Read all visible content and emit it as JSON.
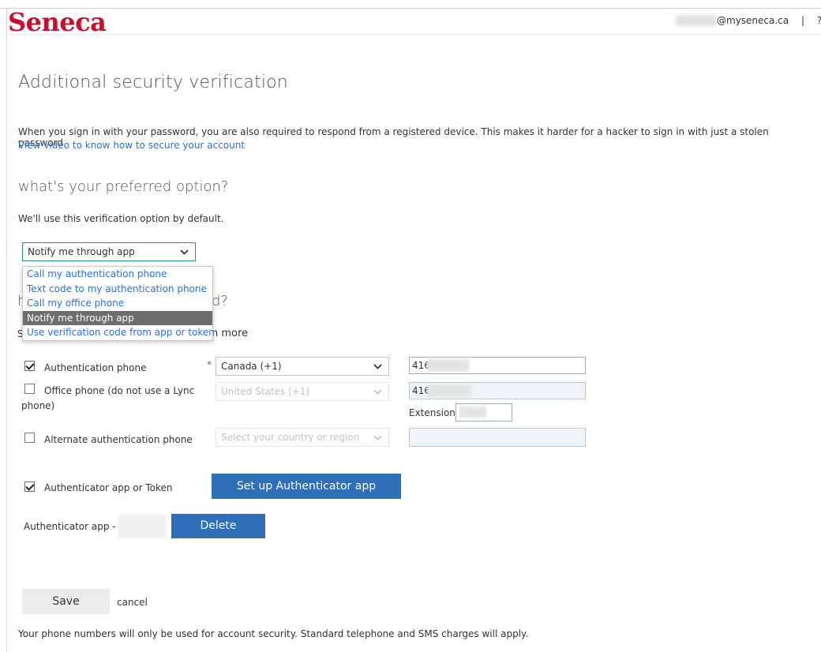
{
  "header": {
    "logo_text": "Seneca",
    "user_email": "@myseneca.ca",
    "separator": "|"
  },
  "page": {
    "title": "Additional security verification",
    "description": "When you sign in with your password, you are also required to respond from a registered device. This makes it harder for a hacker to sign in with just a stolen password.",
    "video_link": "View video to know how to secure your account"
  },
  "preferred": {
    "heading": "what's your preferred option?",
    "subtext": "We'll use this verification option by default.",
    "selected": "Notify me through app",
    "options": [
      "Call my authentication phone",
      "Text code to my authentication phone",
      "Call my office phone",
      "Notify me through app",
      "Use verification code from app or token"
    ]
  },
  "respond": {
    "heading_left": "h",
    "heading_right": "d?",
    "sub_left": "S",
    "learn_more_suffix": "n more"
  },
  "phones": {
    "auth_phone": {
      "label": "Authentication phone",
      "checked": true,
      "country": "Canada (+1)",
      "number_prefix": "416"
    },
    "office_phone": {
      "label_line1": "Office phone (do not use a Lync",
      "label_line2": "phone)",
      "checked": false,
      "country": "United States (+1)",
      "number_prefix": "416",
      "extension_label": "Extension"
    },
    "alternate_phone": {
      "label": "Alternate authentication phone",
      "checked": false,
      "country_placeholder": "Select your country or region"
    },
    "required_marker": "*"
  },
  "authenticator": {
    "label": "Authenticator app or Token",
    "checked": true,
    "setup_button": "Set up Authenticator app",
    "app_label": "Authenticator app -",
    "delete_button": "Delete"
  },
  "actions": {
    "save": "Save",
    "cancel": "cancel"
  },
  "footer": {
    "note": "Your phone numbers will only be used for account security. Standard telephone and SMS charges will apply."
  },
  "colors": {
    "brand_red": "#c8102e",
    "link_blue": "#2672ec",
    "button_blue": "#2e6fb8",
    "dropdown_selected": "#6e6e6e"
  }
}
